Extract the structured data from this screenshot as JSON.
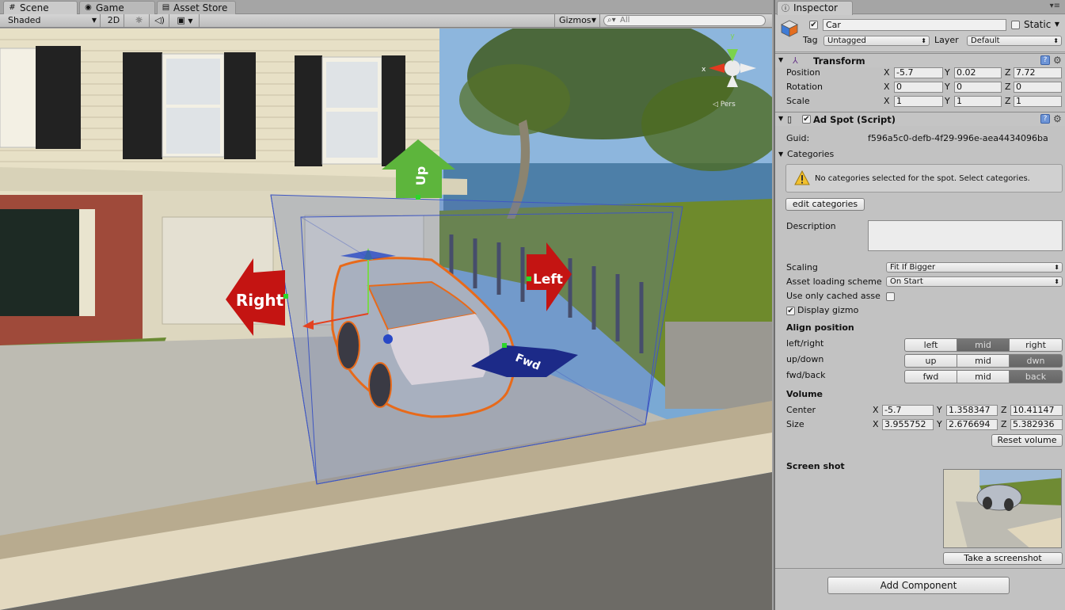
{
  "tabs": [
    {
      "label": "Scene",
      "icon": "scene-icon"
    },
    {
      "label": "Game",
      "icon": "game-icon"
    },
    {
      "label": "Asset Store",
      "icon": "asset-store-icon"
    }
  ],
  "scene_toolbar": {
    "shading": "Shaded",
    "mode_2d": "2D",
    "lighting_icon": "sun-icon",
    "audio_icon": "speaker-icon",
    "effects_icon": "image-icon",
    "gizmos": "Gizmos",
    "search_placeholder": "All"
  },
  "scene": {
    "handle_labels": {
      "up": "Up",
      "left": "Left",
      "right": "Right",
      "fwd": "Fwd"
    },
    "axis_labels": {
      "y": "y",
      "x": "x"
    },
    "view_label": "◁ Pers"
  },
  "inspector": {
    "tab_label": "Inspector",
    "object": {
      "name": "Car",
      "active": true,
      "static_label": "Static",
      "tag_label": "Tag",
      "tag_value": "Untagged",
      "layer_label": "Layer",
      "layer_value": "Default"
    },
    "transform": {
      "title": "Transform",
      "position_label": "Position",
      "rotation_label": "Rotation",
      "scale_label": "Scale",
      "axes": [
        "X",
        "Y",
        "Z"
      ],
      "position": [
        "-5.7",
        "0.02",
        "7.72"
      ],
      "rotation": [
        "0",
        "0",
        "0"
      ],
      "scale": [
        "1",
        "1",
        "1"
      ]
    },
    "ad_spot": {
      "title": "Ad Spot (Script)",
      "guid_label": "Guid:",
      "guid_value": "f596a5c0-defb-4f29-996e-aea4434096ba",
      "categories_label": "Categories",
      "warning_text": "No categories selected for the spot. Select categories.",
      "edit_categories": "edit categories",
      "description_label": "Description",
      "description_value": "",
      "scaling_label": "Scaling",
      "scaling_value": "Fit If Bigger",
      "loading_label": "Asset loading scheme",
      "loading_value": "On Start",
      "cached_label": "Use only cached asse",
      "cached_checked": false,
      "gizmo_label": "Display gizmo",
      "gizmo_checked": true,
      "align_title": "Align position",
      "lr_label": "left/right",
      "lr_options": [
        "left",
        "mid",
        "right"
      ],
      "lr_selected": "mid",
      "ud_label": "up/down",
      "ud_options": [
        "up",
        "mid",
        "dwn"
      ],
      "ud_selected": "dwn",
      "fb_label": "fwd/back",
      "fb_options": [
        "fwd",
        "mid",
        "back"
      ],
      "fb_selected": "back",
      "volume_title": "Volume",
      "center_label": "Center",
      "center": [
        "-5.7",
        "1.358347",
        "10.41147"
      ],
      "size_label": "Size",
      "size": [
        "3.955752",
        "2.676694",
        "5.382936"
      ],
      "reset_volume": "Reset volume",
      "screenshot_title": "Screen shot",
      "take_screenshot": "Take a screenshot"
    },
    "add_component": "Add Component"
  }
}
